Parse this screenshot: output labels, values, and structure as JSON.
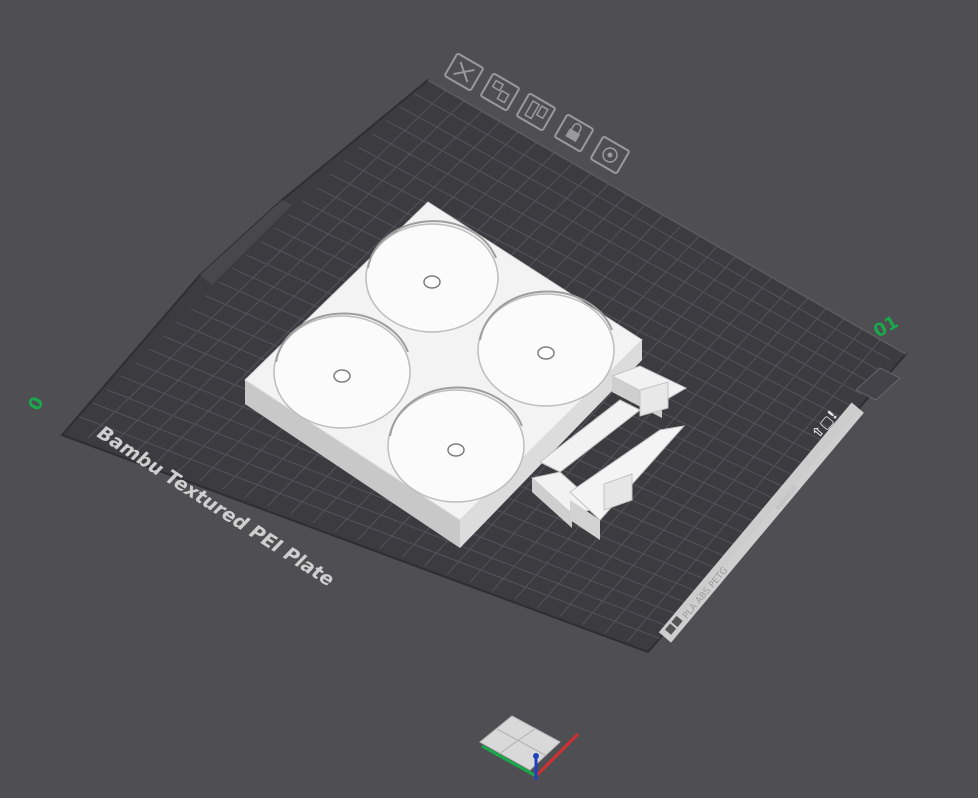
{
  "viewport": {
    "background": "#4f4e53",
    "plate_color": "#3d3c41",
    "grid_color": "#55545a",
    "model_color": "#f1f1f1"
  },
  "plate": {
    "name": "Bambu Textured PEI Plate",
    "bed_label": "PLA  ABS  PETG",
    "bed_sublabel": "ooooooo",
    "corner_icons": "⇧▢!"
  },
  "plate_toolbar": {
    "items": [
      {
        "name": "delete-plate-icon",
        "glyph": "close"
      },
      {
        "name": "arrange-plate-icon",
        "glyph": "arrange"
      },
      {
        "name": "orient-plate-icon",
        "glyph": "orient"
      },
      {
        "name": "lock-plate-icon",
        "glyph": "lock"
      },
      {
        "name": "plate-settings-icon",
        "glyph": "settings"
      }
    ]
  },
  "axis_labels": {
    "x_max": "01",
    "origin": "0"
  },
  "axes": {
    "x_color": "#d03030",
    "y_color": "#19a84a",
    "z_color": "#2040c0"
  }
}
